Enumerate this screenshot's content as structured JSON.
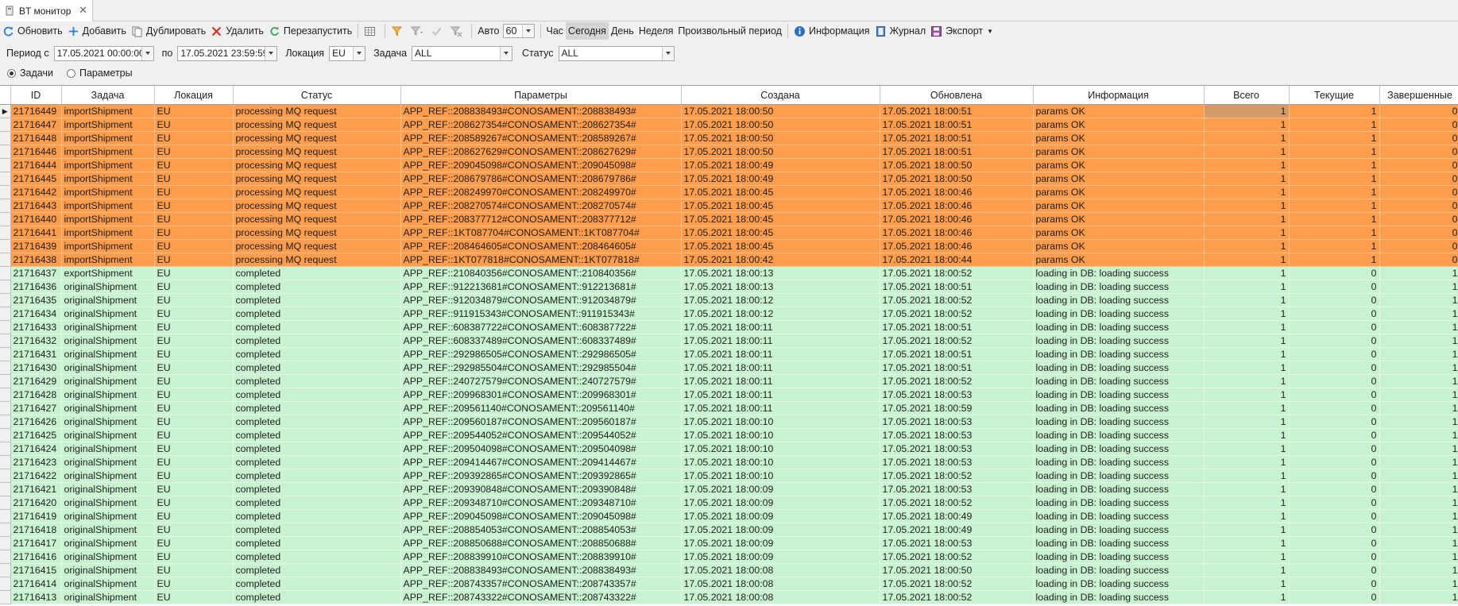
{
  "tab": {
    "title": "BT монитор"
  },
  "toolbar": {
    "refresh": "Обновить",
    "add": "Добавить",
    "duplicate": "Дублировать",
    "delete": "Удалить",
    "restart": "Перезапустить",
    "auto_label": "Авто",
    "auto_value": "60",
    "hour": "Час",
    "today": "Сегодня",
    "day": "День",
    "week": "Неделя",
    "custom_period": "Произвольный период",
    "info": "Информация",
    "journal": "Журнал",
    "export": "Экспорт"
  },
  "filters": {
    "period_from_label": "Период с",
    "period_from": "17.05.2021 00:00:00",
    "period_to_label": "по",
    "period_to": "17.05.2021 23:59:59",
    "location_label": "Локация",
    "location": "EU",
    "task_label": "Задача",
    "task": "ALL",
    "status_label": "Статус",
    "status": "ALL"
  },
  "mode": {
    "tasks": "Задачи",
    "params": "Параметры"
  },
  "columns": [
    "ID",
    "Задача",
    "Локация",
    "Статус",
    "Параметры",
    "Создана",
    "Обновлена",
    "Информация",
    "Всего",
    "Текущие",
    "Завершенные"
  ],
  "rows": [
    [
      "21716449",
      "importShipment",
      "EU",
      "processing MQ request",
      "APP_REF::208838493#CONOSAMENT::208838493#",
      "17.05.2021 18:00:50",
      "17.05.2021 18:00:51",
      "params OK",
      "1",
      "1",
      "0"
    ],
    [
      "21716447",
      "importShipment",
      "EU",
      "processing MQ request",
      "APP_REF::208627354#CONOSAMENT::208627354#",
      "17.05.2021 18:00:50",
      "17.05.2021 18:00:51",
      "params OK",
      "1",
      "1",
      "0"
    ],
    [
      "21716448",
      "importShipment",
      "EU",
      "processing MQ request",
      "APP_REF::208589267#CONOSAMENT::208589267#",
      "17.05.2021 18:00:50",
      "17.05.2021 18:00:51",
      "params OK",
      "1",
      "1",
      "0"
    ],
    [
      "21716446",
      "importShipment",
      "EU",
      "processing MQ request",
      "APP_REF::208627629#CONOSAMENT::208627629#",
      "17.05.2021 18:00:50",
      "17.05.2021 18:00:51",
      "params OK",
      "1",
      "1",
      "0"
    ],
    [
      "21716444",
      "importShipment",
      "EU",
      "processing MQ request",
      "APP_REF::209045098#CONOSAMENT::209045098#",
      "17.05.2021 18:00:49",
      "17.05.2021 18:00:50",
      "params OK",
      "1",
      "1",
      "0"
    ],
    [
      "21716445",
      "importShipment",
      "EU",
      "processing MQ request",
      "APP_REF::208679786#CONOSAMENT::208679786#",
      "17.05.2021 18:00:49",
      "17.05.2021 18:00:50",
      "params OK",
      "1",
      "1",
      "0"
    ],
    [
      "21716442",
      "importShipment",
      "EU",
      "processing MQ request",
      "APP_REF::208249970#CONOSAMENT::208249970#",
      "17.05.2021 18:00:45",
      "17.05.2021 18:00:46",
      "params OK",
      "1",
      "1",
      "0"
    ],
    [
      "21716443",
      "importShipment",
      "EU",
      "processing MQ request",
      "APP_REF::208270574#CONOSAMENT::208270574#",
      "17.05.2021 18:00:45",
      "17.05.2021 18:00:46",
      "params OK",
      "1",
      "1",
      "0"
    ],
    [
      "21716440",
      "importShipment",
      "EU",
      "processing MQ request",
      "APP_REF::208377712#CONOSAMENT::208377712#",
      "17.05.2021 18:00:45",
      "17.05.2021 18:00:46",
      "params OK",
      "1",
      "1",
      "0"
    ],
    [
      "21716441",
      "importShipment",
      "EU",
      "processing MQ request",
      "APP_REF::1KT087704#CONOSAMENT::1KT087704#",
      "17.05.2021 18:00:45",
      "17.05.2021 18:00:46",
      "params OK",
      "1",
      "1",
      "0"
    ],
    [
      "21716439",
      "importShipment",
      "EU",
      "processing MQ request",
      "APP_REF::208464605#CONOSAMENT::208464605#",
      "17.05.2021 18:00:45",
      "17.05.2021 18:00:46",
      "params OK",
      "1",
      "1",
      "0"
    ],
    [
      "21716438",
      "importShipment",
      "EU",
      "processing MQ request",
      "APP_REF::1KT077818#CONOSAMENT::1KT077818#",
      "17.05.2021 18:00:42",
      "17.05.2021 18:00:44",
      "params OK",
      "1",
      "1",
      "0"
    ],
    [
      "21716437",
      "exportShipment",
      "EU",
      "completed",
      "APP_REF::210840356#CONOSAMENT::210840356#",
      "17.05.2021 18:00:13",
      "17.05.2021 18:00:52",
      "loading in DB:  loading success",
      "1",
      "0",
      "1"
    ],
    [
      "21716436",
      "originalShipment",
      "EU",
      "completed",
      "APP_REF::912213681#CONOSAMENT::912213681#",
      "17.05.2021 18:00:13",
      "17.05.2021 18:00:51",
      "loading in DB:  loading success",
      "1",
      "0",
      "1"
    ],
    [
      "21716435",
      "originalShipment",
      "EU",
      "completed",
      "APP_REF::912034879#CONOSAMENT::912034879#",
      "17.05.2021 18:00:12",
      "17.05.2021 18:00:52",
      "loading in DB:  loading success",
      "1",
      "0",
      "1"
    ],
    [
      "21716434",
      "originalShipment",
      "EU",
      "completed",
      "APP_REF::911915343#CONOSAMENT::911915343#",
      "17.05.2021 18:00:12",
      "17.05.2021 18:00:52",
      "loading in DB:  loading success",
      "1",
      "0",
      "1"
    ],
    [
      "21716433",
      "originalShipment",
      "EU",
      "completed",
      "APP_REF::608387722#CONOSAMENT::608387722#",
      "17.05.2021 18:00:11",
      "17.05.2021 18:00:51",
      "loading in DB:  loading success",
      "1",
      "0",
      "1"
    ],
    [
      "21716432",
      "originalShipment",
      "EU",
      "completed",
      "APP_REF::608337489#CONOSAMENT::608337489#",
      "17.05.2021 18:00:11",
      "17.05.2021 18:00:52",
      "loading in DB:  loading success",
      "1",
      "0",
      "1"
    ],
    [
      "21716431",
      "originalShipment",
      "EU",
      "completed",
      "APP_REF::292986505#CONOSAMENT::292986505#",
      "17.05.2021 18:00:11",
      "17.05.2021 18:00:51",
      "loading in DB:  loading success",
      "1",
      "0",
      "1"
    ],
    [
      "21716430",
      "originalShipment",
      "EU",
      "completed",
      "APP_REF::292985504#CONOSAMENT::292985504#",
      "17.05.2021 18:00:11",
      "17.05.2021 18:00:51",
      "loading in DB:  loading success",
      "1",
      "0",
      "1"
    ],
    [
      "21716429",
      "originalShipment",
      "EU",
      "completed",
      "APP_REF::240727579#CONOSAMENT::240727579#",
      "17.05.2021 18:00:11",
      "17.05.2021 18:00:52",
      "loading in DB:  loading success",
      "1",
      "0",
      "1"
    ],
    [
      "21716428",
      "originalShipment",
      "EU",
      "completed",
      "APP_REF::209968301#CONOSAMENT::209968301#",
      "17.05.2021 18:00:11",
      "17.05.2021 18:00:53",
      "loading in DB:  loading success",
      "1",
      "0",
      "1"
    ],
    [
      "21716427",
      "originalShipment",
      "EU",
      "completed",
      "APP_REF::209561140#CONOSAMENT::209561140#",
      "17.05.2021 18:00:11",
      "17.05.2021 18:00:59",
      "loading in DB:  loading success",
      "1",
      "0",
      "1"
    ],
    [
      "21716426",
      "originalShipment",
      "EU",
      "completed",
      "APP_REF::209560187#CONOSAMENT::209560187#",
      "17.05.2021 18:00:10",
      "17.05.2021 18:00:53",
      "loading in DB:  loading success",
      "1",
      "0",
      "1"
    ],
    [
      "21716425",
      "originalShipment",
      "EU",
      "completed",
      "APP_REF::209544052#CONOSAMENT::209544052#",
      "17.05.2021 18:00:10",
      "17.05.2021 18:00:53",
      "loading in DB:  loading success",
      "1",
      "0",
      "1"
    ],
    [
      "21716424",
      "originalShipment",
      "EU",
      "completed",
      "APP_REF::209504098#CONOSAMENT::209504098#",
      "17.05.2021 18:00:10",
      "17.05.2021 18:00:53",
      "loading in DB:  loading success",
      "1",
      "0",
      "1"
    ],
    [
      "21716423",
      "originalShipment",
      "EU",
      "completed",
      "APP_REF::209414467#CONOSAMENT::209414467#",
      "17.05.2021 18:00:10",
      "17.05.2021 18:00:53",
      "loading in DB:  loading success",
      "1",
      "0",
      "1"
    ],
    [
      "21716422",
      "originalShipment",
      "EU",
      "completed",
      "APP_REF::209392865#CONOSAMENT::209392865#",
      "17.05.2021 18:00:10",
      "17.05.2021 18:00:52",
      "loading in DB:  loading success",
      "1",
      "0",
      "1"
    ],
    [
      "21716421",
      "originalShipment",
      "EU",
      "completed",
      "APP_REF::209390848#CONOSAMENT::209390848#",
      "17.05.2021 18:00:09",
      "17.05.2021 18:00:53",
      "loading in DB:  loading success",
      "1",
      "0",
      "1"
    ],
    [
      "21716420",
      "originalShipment",
      "EU",
      "completed",
      "APP_REF::209348710#CONOSAMENT::209348710#",
      "17.05.2021 18:00:09",
      "17.05.2021 18:00:52",
      "loading in DB:  loading success",
      "1",
      "0",
      "1"
    ],
    [
      "21716419",
      "originalShipment",
      "EU",
      "completed",
      "APP_REF::209045098#CONOSAMENT::209045098#",
      "17.05.2021 18:00:09",
      "17.05.2021 18:00:49",
      "loading in DB:  loading success",
      "1",
      "0",
      "1"
    ],
    [
      "21716418",
      "originalShipment",
      "EU",
      "completed",
      "APP_REF::208854053#CONOSAMENT::208854053#",
      "17.05.2021 18:00:09",
      "17.05.2021 18:00:49",
      "loading in DB:  loading success",
      "1",
      "0",
      "1"
    ],
    [
      "21716417",
      "originalShipment",
      "EU",
      "completed",
      "APP_REF::208850688#CONOSAMENT::208850688#",
      "17.05.2021 18:00:09",
      "17.05.2021 18:00:53",
      "loading in DB:  loading success",
      "1",
      "0",
      "1"
    ],
    [
      "21716416",
      "originalShipment",
      "EU",
      "completed",
      "APP_REF::208839910#CONOSAMENT::208839910#",
      "17.05.2021 18:00:09",
      "17.05.2021 18:00:52",
      "loading in DB:  loading success",
      "1",
      "0",
      "1"
    ],
    [
      "21716415",
      "originalShipment",
      "EU",
      "completed",
      "APP_REF::208838493#CONOSAMENT::208838493#",
      "17.05.2021 18:00:08",
      "17.05.2021 18:00:50",
      "loading in DB:  loading success",
      "1",
      "0",
      "1"
    ],
    [
      "21716414",
      "originalShipment",
      "EU",
      "completed",
      "APP_REF::208743357#CONOSAMENT::208743357#",
      "17.05.2021 18:00:08",
      "17.05.2021 18:00:52",
      "loading in DB:  loading success",
      "1",
      "0",
      "1"
    ],
    [
      "21716413",
      "originalShipment",
      "EU",
      "completed",
      "APP_REF::208743322#CONOSAMENT::208743322#",
      "17.05.2021 18:00:08",
      "17.05.2021 18:00:52",
      "loading in DB:  loading success",
      "1",
      "0",
      "1"
    ]
  ],
  "colors": {
    "processing": "#ff9d4e",
    "completed": "#c9f3d0",
    "focus_cell": "#d49a67"
  }
}
